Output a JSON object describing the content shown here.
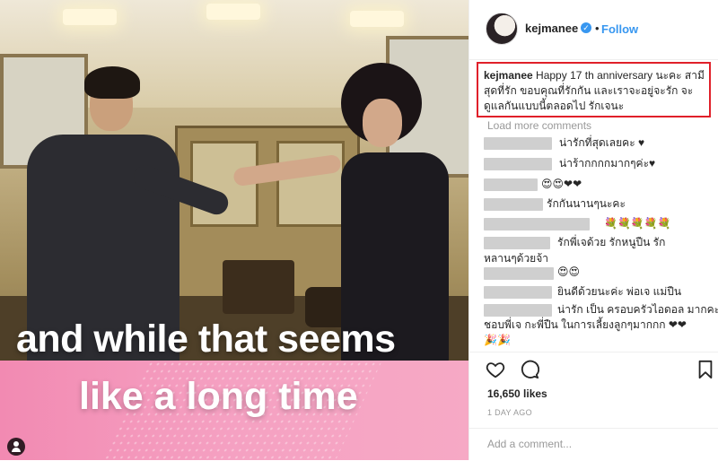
{
  "photo": {
    "caption_line1": "and while that seems",
    "caption_line2": "like a long time"
  },
  "post": {
    "username": "kejmanee",
    "verified_glyph": "✓",
    "separator": "•",
    "follow_label": "Follow",
    "caption_user": "kejmanee",
    "caption_text": "Happy 17 th anniversary นะคะ สามีสุดที่รัก ขอบคุณที่รักกัน และเราจะอยู่จะรัก จะดูแลกันแบบนี้ตลอดไป รักเจนะ",
    "load_more": "Load more comments",
    "comments": [
      {
        "text": "น่ารักที่สุดเลยคะ ♥"
      },
      {
        "text": "น่าร้ากกกกมากๆค่ะ♥"
      },
      {
        "text": "😍😍❤❤"
      },
      {
        "text": "รักกันนานๆนะคะ"
      },
      {
        "text": "💐💐💐💐💐"
      },
      {
        "text": "รักพี่เจด้วย รักหนูปืน รัก"
      },
      {
        "text": "หลานๆด้วยจ้า"
      },
      {
        "text": "😍😍"
      },
      {
        "text": "ยินดีด้วยนะค่ะ พ่อเจ แม่ปืน"
      },
      {
        "text": "น่ารัก เป็น ครอบครัวไอดอล มากคะ"
      },
      {
        "text": "ชอบพี่เจ กะพี่ปืน ในการเลี้ยงลูกๆมากกก ❤❤"
      },
      {
        "text": "🎉🎉"
      }
    ],
    "likes": "16,650 likes",
    "date": "1 DAY AGO",
    "add_comment_placeholder": "Add a comment..."
  },
  "colors": {
    "accent": "#3897f0",
    "highlight_box": "#e0202a"
  },
  "icons": [
    "heart-icon",
    "comment-icon",
    "bookmark-icon",
    "tag-user-icon",
    "verified-icon"
  ]
}
